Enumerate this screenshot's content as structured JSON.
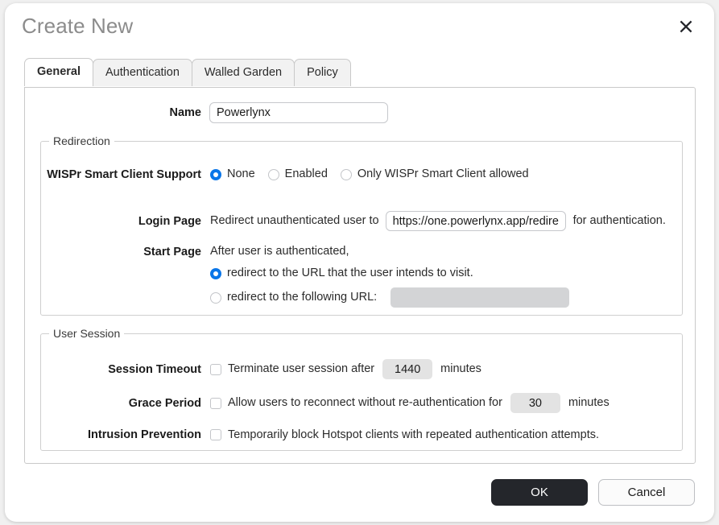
{
  "dialog": {
    "title": "Create New",
    "close_icon": "close-x-icon"
  },
  "tabs": [
    {
      "label": "General",
      "active": true
    },
    {
      "label": "Authentication",
      "active": false
    },
    {
      "label": "Walled Garden",
      "active": false
    },
    {
      "label": "Policy",
      "active": false
    }
  ],
  "general": {
    "name": {
      "label": "Name",
      "value": "Powerlynx",
      "placeholder": ""
    },
    "redirection": {
      "legend": "Redirection",
      "wispr": {
        "label": "WISPr Smart Client Support",
        "options": [
          {
            "label": "None",
            "selected": true
          },
          {
            "label": "Enabled",
            "selected": false
          },
          {
            "label": "Only WISPr Smart Client allowed",
            "selected": false
          }
        ]
      },
      "login_page": {
        "label": "Login Page",
        "prefix_text": "Redirect unauthenticated user to",
        "url_value": "https://one.powerlynx.app/redirect",
        "url_placeholder": "",
        "suffix_text": "for authentication."
      },
      "start_page": {
        "label": "Start Page",
        "intro_text": "After user is authenticated,",
        "options": [
          {
            "label": "redirect to the URL that the user intends to visit.",
            "selected": true
          },
          {
            "label": "redirect to the following URL:",
            "selected": false
          }
        ],
        "following_url_value": "",
        "following_url_placeholder": "",
        "following_url_disabled": true
      }
    },
    "user_session": {
      "legend": "User Session",
      "session_timeout": {
        "label": "Session Timeout",
        "checked": false,
        "text_before": "Terminate user session after",
        "value": "1440",
        "unit": "minutes"
      },
      "grace_period": {
        "label": "Grace Period",
        "checked": false,
        "text_before": "Allow users to reconnect without re-authentication for",
        "value": "30",
        "unit": "minutes"
      },
      "intrusion_prevention": {
        "label": "Intrusion Prevention",
        "checked": false,
        "text": "Temporarily block Hotspot clients with repeated authentication attempts."
      }
    }
  },
  "footer": {
    "ok_label": "OK",
    "cancel_label": "Cancel"
  },
  "colors": {
    "accent": "#0a76e8",
    "primary_button": "#24262b",
    "title_text": "#8c8c8c",
    "disabled_field": "#d3d4d6"
  }
}
